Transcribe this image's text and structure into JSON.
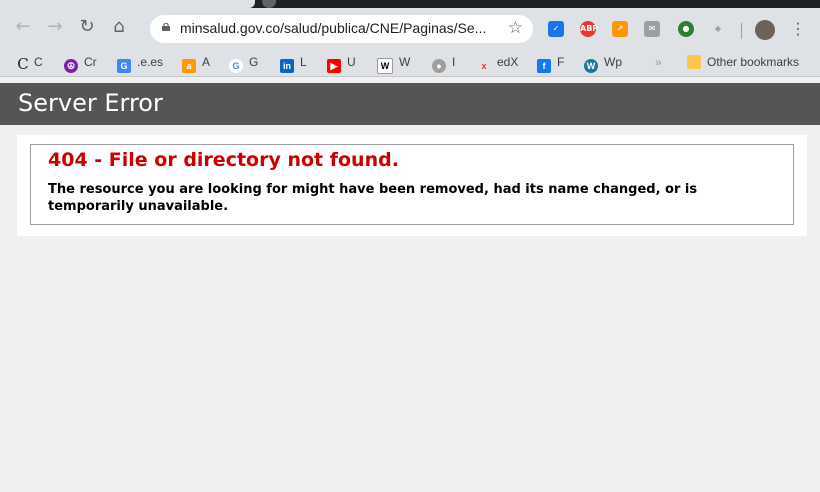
{
  "browser": {
    "url": "minsalud.gov.co/salud/publica/CNE/Paginas/Se...",
    "bookmarks": [
      {
        "label": "C",
        "icon": "letter-c-icon"
      },
      {
        "label": "Cr",
        "icon": "peace-icon"
      },
      {
        "label": ".e.es",
        "icon": "translate-icon"
      },
      {
        "label": "A",
        "icon": "amazon-icon"
      },
      {
        "label": "G",
        "icon": "google-icon"
      },
      {
        "label": "L",
        "icon": "linkedin-icon"
      },
      {
        "label": "U",
        "icon": "youtube-icon"
      },
      {
        "label": "W",
        "icon": "wikipedia-icon"
      },
      {
        "label": "I",
        "icon": "globe-icon"
      },
      {
        "label": "edX",
        "icon": "edx-icon"
      },
      {
        "label": "F",
        "icon": "facebook-icon"
      },
      {
        "label": "Wp",
        "icon": "wordpress-icon"
      }
    ],
    "other_bookmarks": "Other bookmarks",
    "overflow": "»"
  },
  "page": {
    "banner_title": "Server Error",
    "error_heading": "404 - File or directory not found.",
    "error_message": "The resource you are looking for might have been removed, had its name changed, or is temporarily unavailable."
  },
  "colors": {
    "banner": "#555555",
    "error_heading": "#cc0000",
    "page_bg": "#f0f0f0"
  }
}
